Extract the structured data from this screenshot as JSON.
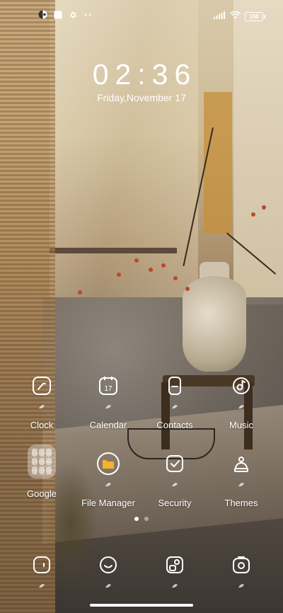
{
  "status_bar": {
    "left_icons": [
      "color-palette-icon",
      "square-notification-icon",
      "gear-icon",
      "more-dots-icon"
    ],
    "right_icons": [
      "signal-bars-icon",
      "wifi-icon"
    ],
    "battery": "100"
  },
  "lock_clock": {
    "time": "02:36",
    "date": "Friday,November 17"
  },
  "apps": {
    "clock": "Clock",
    "calendar": "Calendar",
    "calendar_day": "17",
    "contacts": "Contacts",
    "music": "Music",
    "google": "Google",
    "file_manager": "File Manager",
    "security": "Security",
    "themes": "Themes"
  },
  "pages": {
    "count": 2,
    "current": 1
  },
  "colors": {
    "file_manager_accent": "#f5b22a"
  }
}
